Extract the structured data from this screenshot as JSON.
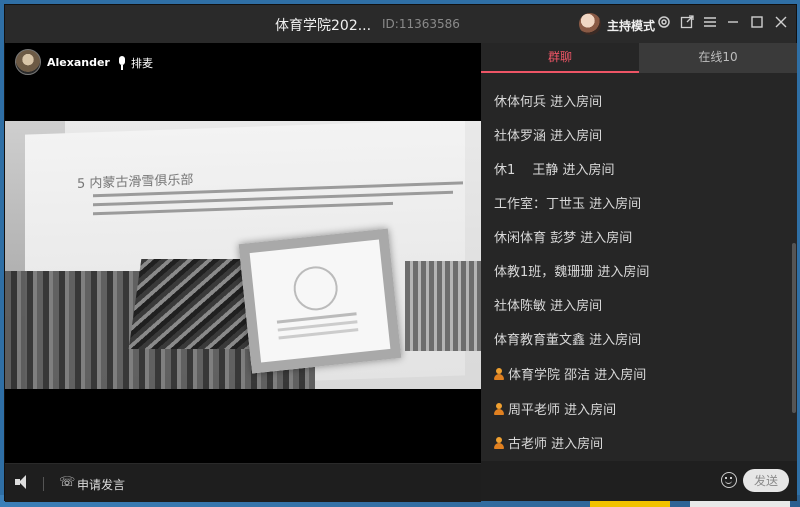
{
  "window": {
    "title": "体育学院202...",
    "room_id": "ID:11363586",
    "host_mode": "主持模式"
  },
  "video": {
    "presenter_name": "Alexander",
    "mic_label": "排麦",
    "slide_heading": "5 内蒙古滑雪俱乐部"
  },
  "controls": {
    "request_label": "申请发言"
  },
  "panel": {
    "tabs": [
      {
        "label": "群聊",
        "active": true
      },
      {
        "label": "在线10",
        "active": false
      }
    ],
    "messages": [
      {
        "text": "休体何兵 进入房间",
        "icon": false
      },
      {
        "text": "社体罗涵 进入房间",
        "icon": false
      },
      {
        "text": "休1　 王静 进入房间",
        "icon": false
      },
      {
        "text": "工作室：丁世玉 进入房间",
        "icon": false
      },
      {
        "text": "休闲体育 彭梦 进入房间",
        "icon": false
      },
      {
        "text": "体教1班，魏珊珊 进入房间",
        "icon": false
      },
      {
        "text": "社体陈敏 进入房间",
        "icon": false
      },
      {
        "text": "体育教育董文鑫 进入房间",
        "icon": false
      },
      {
        "text": "体育学院 邵洁 进入房间",
        "icon": true
      },
      {
        "text": "周平老师 进入房间",
        "icon": true
      },
      {
        "text": "古老师 进入房间",
        "icon": true
      }
    ],
    "input_placeholder": "",
    "send_label": "发送"
  },
  "icons": {
    "settings": "gear-icon",
    "popout": "popout-icon",
    "menu": "menu-icon",
    "minimize": "minimize-icon",
    "maximize": "maximize-icon",
    "close": "close-icon"
  },
  "colors": {
    "accent_tab": "#ee5566",
    "window_bg": "#1e1e1e",
    "panel_bg": "#262626"
  }
}
